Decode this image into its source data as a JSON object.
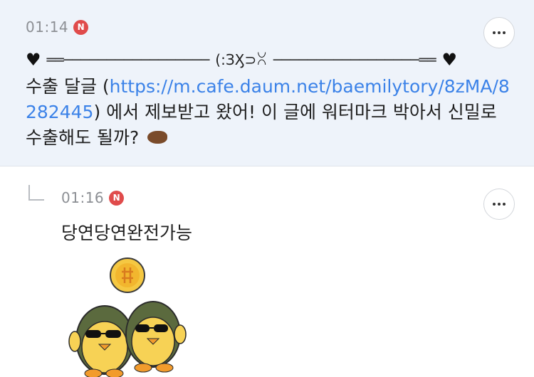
{
  "post": {
    "time": "01:14",
    "badge": "N",
    "deco_left": "═══─────────────────── (: З)(:⊃ꇤ ─────────────────═══",
    "deco_center": "(:ЗӼ⊃ꇤ",
    "deco_left_line": "══─────────────────",
    "deco_right_line": "─────────────────══",
    "text_before_link": "수출 달글 (",
    "link": "https://m.cafe.daum.net/baemilytory/8zMA/8282445",
    "text_after_link": ") 에서 제보받고 왔어! 이 글에 워터마크 박아서 신밀로 수출해도 될까?",
    "emoji": "otter"
  },
  "reply": {
    "time": "01:16",
    "badge": "N",
    "text": "당연당연완전가능",
    "sticker": "two-penguins-with-sunglasses-and-coin-sticker"
  },
  "icons": {
    "more": "more-horizontal-icon",
    "heart": "black-heart-icon",
    "reply": "reply-arrow-icon",
    "otter": "otter-emoji-icon"
  },
  "colors": {
    "post_bg": "#eef3fa",
    "link": "#3b82e8",
    "badge": "#e04b4b",
    "time": "#8c8f94"
  }
}
